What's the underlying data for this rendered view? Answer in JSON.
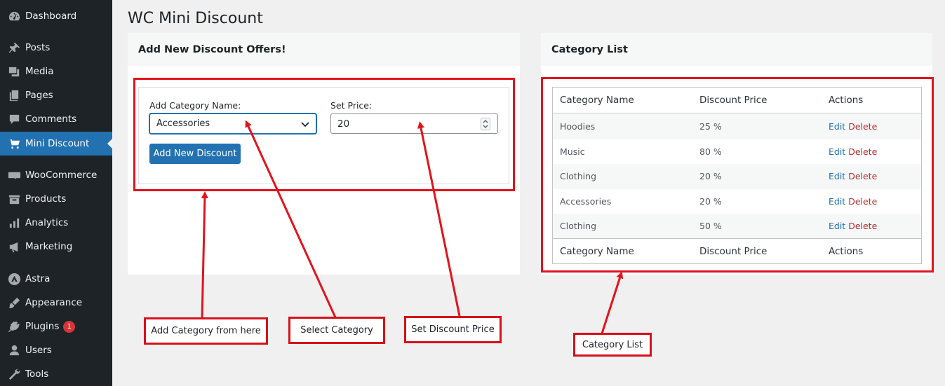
{
  "sidebar": {
    "items": [
      {
        "label": "Dashboard",
        "icon": "dashboard-icon"
      },
      {
        "label": "Posts",
        "icon": "pin-icon"
      },
      {
        "label": "Media",
        "icon": "media-icon"
      },
      {
        "label": "Pages",
        "icon": "pages-icon"
      },
      {
        "label": "Comments",
        "icon": "comments-icon"
      },
      {
        "label": "Mini Discount",
        "icon": "cart-icon",
        "active": true
      },
      {
        "label": "WooCommerce",
        "icon": "woo-icon"
      },
      {
        "label": "Products",
        "icon": "products-icon"
      },
      {
        "label": "Analytics",
        "icon": "analytics-icon"
      },
      {
        "label": "Marketing",
        "icon": "megaphone-icon"
      },
      {
        "label": "Astra",
        "icon": "astra-icon"
      },
      {
        "label": "Appearance",
        "icon": "brush-icon"
      },
      {
        "label": "Plugins",
        "icon": "plugin-icon",
        "badge": "1"
      },
      {
        "label": "Users",
        "icon": "user-icon"
      },
      {
        "label": "Tools",
        "icon": "wrench-icon"
      }
    ]
  },
  "page": {
    "title": "WC Mini Discount"
  },
  "form_panel": {
    "title": "Add New Discount Offers!",
    "category_label": "Add Category Name:",
    "category_value": "Accessories",
    "price_label": "Set Price:",
    "price_value": "20",
    "submit_label": "Add New Discount"
  },
  "list_panel": {
    "title": "Category List",
    "columns": [
      "Category Name",
      "Discount Price",
      "Actions"
    ],
    "footer_columns": [
      "Category Name",
      "Discount Price",
      "Actions"
    ],
    "rows": [
      {
        "name": "Hoodies",
        "price": "25 %",
        "edit": "Edit",
        "delete": "Delete"
      },
      {
        "name": "Music",
        "price": "80 %",
        "edit": "Edit",
        "delete": "Delete"
      },
      {
        "name": "Clothing",
        "price": "20 %",
        "edit": "Edit",
        "delete": "Delete"
      },
      {
        "name": "Accessories",
        "price": "20 %",
        "edit": "Edit",
        "delete": "Delete"
      },
      {
        "name": "Clothing",
        "price": "50 %",
        "edit": "Edit",
        "delete": "Delete"
      }
    ]
  },
  "annotations": {
    "add_category": "Add Category from here",
    "select_category": "Select Category",
    "set_price": "Set Discount Price",
    "category_list": "Category List"
  },
  "colors": {
    "accent": "#2271b1",
    "annotation_red": "#e1141c",
    "delete_red": "#b32d2e",
    "sidebar_bg": "#1d2327"
  }
}
